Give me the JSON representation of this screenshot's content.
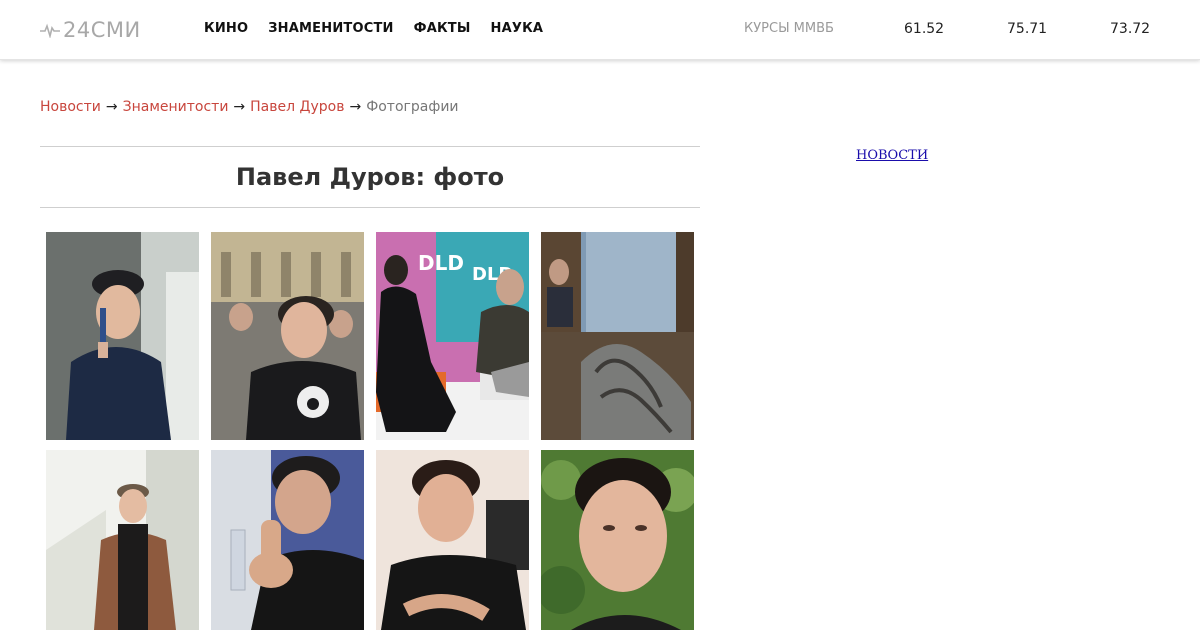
{
  "logo": {
    "text": "24СМИ",
    "icon": "pulse-icon"
  },
  "nav": [
    "КИНО",
    "ЗНАМЕНИТОСТИ",
    "ФАКТЫ",
    "НАУКА"
  ],
  "rates": {
    "label": "КУРСЫ ММВБ",
    "values": [
      "61.52",
      "75.71",
      "73.72"
    ]
  },
  "breadcrumb": {
    "items": [
      "Новости",
      "Знаменитости",
      "Павел Дуров"
    ],
    "current": "Фотографии",
    "separator": "→"
  },
  "page_title": "Павел Дуров: фото",
  "side_link": "НОВОСТИ",
  "photos": {
    "row1": [
      {
        "label": "DLD"
      },
      {
        "label": ""
      },
      {
        "label": "DLD"
      },
      {
        "label": ""
      }
    ],
    "banner_text": "DLD"
  },
  "colors": {
    "link_red": "#c8463d",
    "side_link_blue": "#1a0dab",
    "logo_gray": "#a8a8a8"
  }
}
